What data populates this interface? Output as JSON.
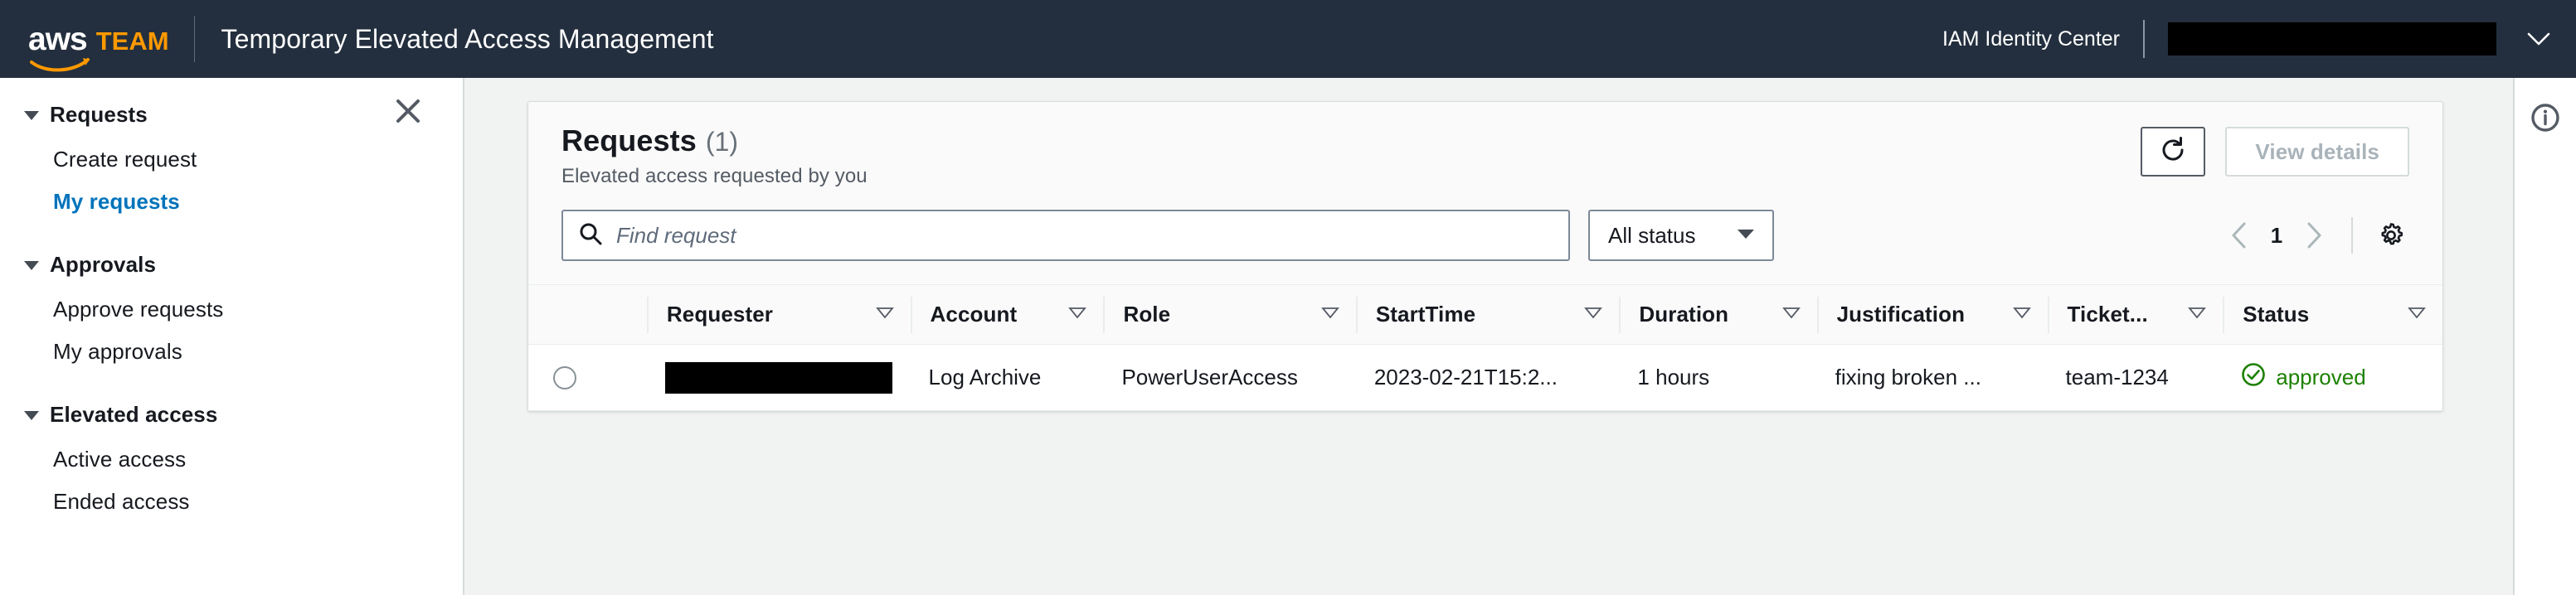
{
  "header": {
    "logo_aws": "aws",
    "logo_team": "TEAM",
    "app_title": "Temporary Elevated Access Management",
    "identity_provider": "IAM Identity Center",
    "account_redacted": "",
    "caret_icon": "chevron-down-icon"
  },
  "sidebar": {
    "close_icon": "close-icon",
    "groups": [
      {
        "title": "Requests",
        "items": [
          {
            "label": "Create request",
            "active": false
          },
          {
            "label": "My requests",
            "active": true
          }
        ]
      },
      {
        "title": "Approvals",
        "items": [
          {
            "label": "Approve requests",
            "active": false
          },
          {
            "label": "My approvals",
            "active": false
          }
        ]
      },
      {
        "title": "Elevated access",
        "items": [
          {
            "label": "Active access",
            "active": false
          },
          {
            "label": "Ended access",
            "active": false
          }
        ]
      }
    ]
  },
  "card": {
    "title": "Requests",
    "count": "(1)",
    "subtitle": "Elevated access requested by you",
    "refresh_icon": "refresh-icon",
    "view_details_label": "View details",
    "search": {
      "icon": "search-icon",
      "value": "",
      "placeholder": "Find request"
    },
    "status_filter": {
      "selected": "All status",
      "caret_icon": "caret-down-icon"
    },
    "pagination": {
      "prev_icon": "chevron-left-icon",
      "page": "1",
      "next_icon": "chevron-right-icon",
      "settings_icon": "gear-icon"
    }
  },
  "table": {
    "columns": [
      "Requester",
      "Account",
      "Role",
      "StartTime",
      "Duration",
      "Justification",
      "Ticket...",
      "Status"
    ],
    "rows": [
      {
        "selected": false,
        "requester": "",
        "account": "Log Archive",
        "role": "PowerUserAccess",
        "start_time": "2023-02-21T15:2...",
        "duration": "1 hours",
        "justification": "fixing broken ...",
        "ticket": "team-1234",
        "status": "approved",
        "status_icon": "check-circle-icon"
      }
    ]
  },
  "right_rail": {
    "info_icon": "info-circle-icon"
  },
  "colors": {
    "nav_background": "#232f3e",
    "brand_orange": "#ff9900",
    "link_active": "#0073bb",
    "status_green": "#1d8102",
    "content_background": "#f1f3f3"
  }
}
